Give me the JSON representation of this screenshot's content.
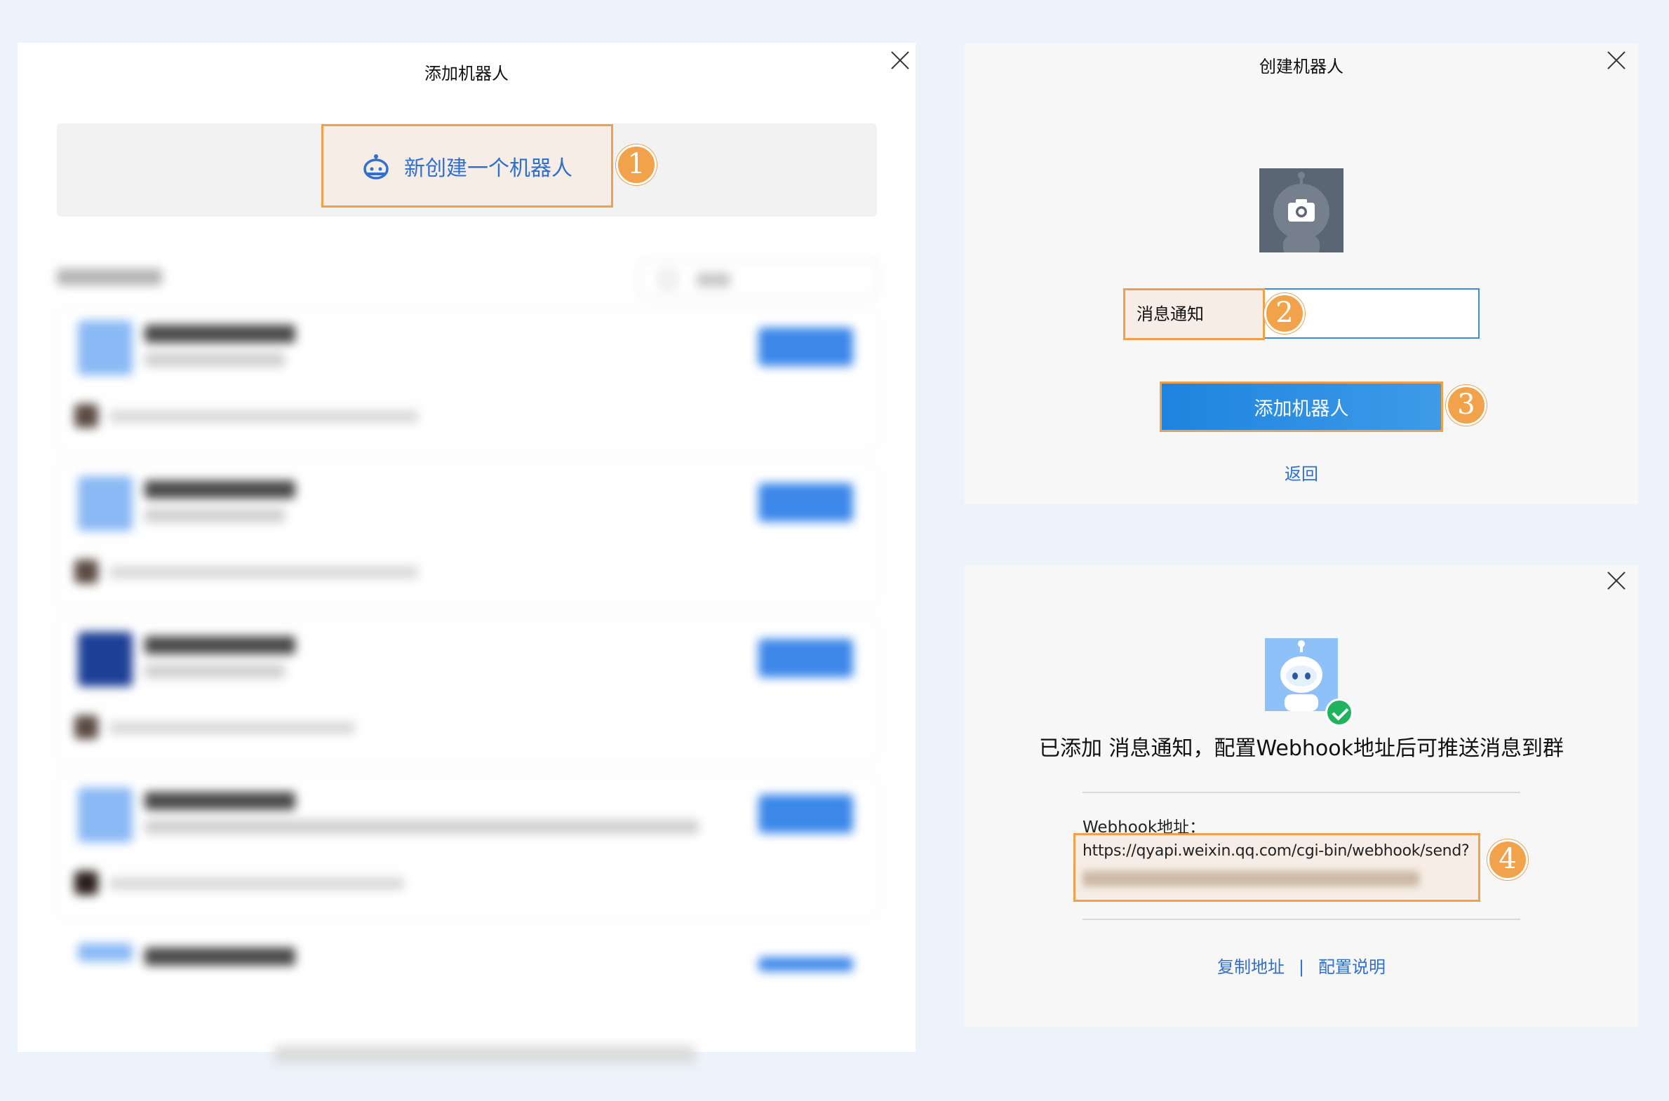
{
  "panel_add": {
    "title": "添加机器人",
    "create_label": "新创建一个机器人",
    "step": "1"
  },
  "panel_create": {
    "title": "创建机器人",
    "name_label": "消息通知",
    "name_value": "",
    "add_button": "添加机器人",
    "back_link": "返回",
    "step_name": "2",
    "step_add": "3"
  },
  "panel_result": {
    "message": "已添加 消息通知，配置Webhook地址后可推送消息到群",
    "webhook_label": "Webhook地址：",
    "webhook_url": "https://qyapi.weixin.qq.com/cgi-bin/webhook/send?",
    "copy_link": "复制地址",
    "separator": "|",
    "help_link": "配置说明",
    "step": "4"
  },
  "colors": {
    "accent_blue": "#2f6fcf",
    "button_blue": "#1f84df",
    "highlight_border": "#f0a04b",
    "highlight_fill": "#f6ede6",
    "success_green": "#1fb35e",
    "page_bg": "#edf3fa"
  },
  "icons": [
    "robot-icon",
    "camera-icon",
    "close-icon",
    "check-icon",
    "search-icon"
  ]
}
